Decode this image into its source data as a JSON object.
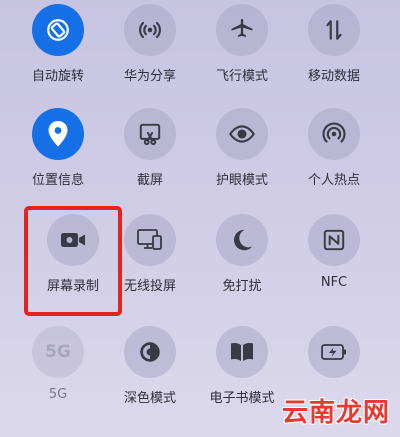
{
  "tiles": [
    {
      "label": "自动旋转",
      "icon": "auto-rotate-icon",
      "state": "on"
    },
    {
      "label": "华为分享",
      "icon": "huawei-share-icon",
      "state": "off"
    },
    {
      "label": "飞行模式",
      "icon": "airplane-icon",
      "state": "off"
    },
    {
      "label": "移动数据",
      "icon": "mobile-data-icon",
      "state": "off"
    },
    {
      "label": "位置信息",
      "icon": "location-icon",
      "state": "on"
    },
    {
      "label": "截屏",
      "icon": "screenshot-icon",
      "state": "off"
    },
    {
      "label": "护眼模式",
      "icon": "eye-icon",
      "state": "off"
    },
    {
      "label": "个人热点",
      "icon": "hotspot-icon",
      "state": "off"
    },
    {
      "label": "屏幕录制",
      "icon": "screen-record-icon",
      "state": "off"
    },
    {
      "label": "无线投屏",
      "icon": "wireless-projection-icon",
      "state": "off"
    },
    {
      "label": "免打扰",
      "icon": "moon-icon",
      "state": "off"
    },
    {
      "label": "NFC",
      "icon": "nfc-icon",
      "state": "off"
    },
    {
      "label": "5G",
      "icon": "5g-icon",
      "state": "disabled",
      "icon_text": "5G"
    },
    {
      "label": "深色模式",
      "icon": "dark-mode-icon",
      "state": "off"
    },
    {
      "label": "电子书模式",
      "icon": "ebook-icon",
      "state": "off"
    },
    {
      "label": "",
      "icon": "battery-saver-icon",
      "state": "off"
    }
  ],
  "watermark": "云南龙网",
  "colors": {
    "active": "#1570e8",
    "highlight": "#e5231c",
    "watermark": "#e8382f"
  }
}
